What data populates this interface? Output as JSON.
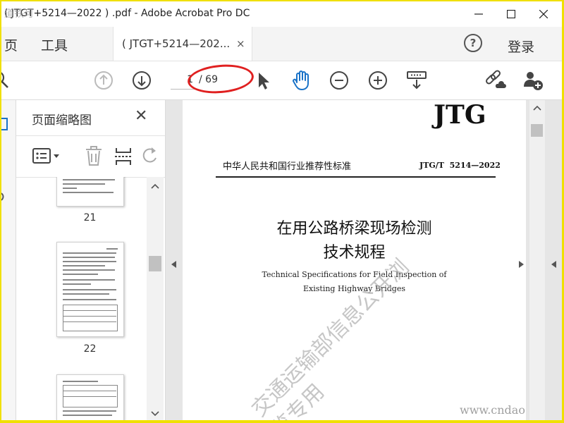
{
  "window": {
    "title": "( JTGT+5214—2022 ) .pdf - Adobe Acrobat Pro DC",
    "title_overlay": "道铁可"
  },
  "menu": {
    "home": "页",
    "tools": "工具",
    "login": "登录"
  },
  "tab": {
    "label": "( JTGT+5214—202...",
    "close": "×"
  },
  "toolbar": {
    "page_current": "1",
    "page_total": "/ 69"
  },
  "thumbnails": {
    "title": "页面缩略图",
    "close": "✕",
    "pages": [
      {
        "label": "21"
      },
      {
        "label": "22"
      }
    ]
  },
  "document": {
    "logo": "JTG",
    "header_left": "中华人民共和国行业推荐性标准",
    "header_right": "JTG/T  5214—2022",
    "title_line1": "在用公路桥梁现场检测",
    "title_line2": "技术规程",
    "subtitle_line1": "Technical Specifications for Field Inspection of",
    "subtitle_line2": "Existing Highway Bridges",
    "watermark": "交通运输部信息公开浏览专用",
    "site_watermark": "www.cndao.com"
  },
  "colors": {
    "page_bg": "#f0e000",
    "highlight": "#e02020",
    "accent_blue": "#1a73c8"
  }
}
